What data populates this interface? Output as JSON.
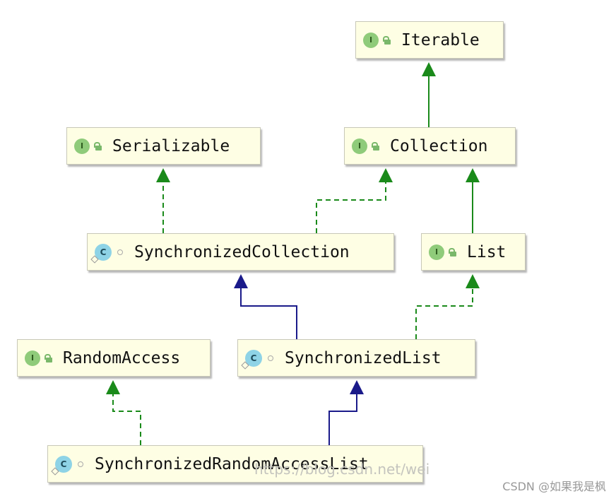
{
  "diagram": {
    "nodes": [
      {
        "id": "iterable",
        "kind": "interface",
        "label": "Iterable"
      },
      {
        "id": "serializable",
        "kind": "interface",
        "label": "Serializable"
      },
      {
        "id": "collection",
        "kind": "interface",
        "label": "Collection"
      },
      {
        "id": "synchronized-collection",
        "kind": "class",
        "label": "SynchronizedCollection"
      },
      {
        "id": "list",
        "kind": "interface",
        "label": "List"
      },
      {
        "id": "random-access",
        "kind": "interface",
        "label": "RandomAccess"
      },
      {
        "id": "synchronized-list",
        "kind": "class",
        "label": "SynchronizedList"
      },
      {
        "id": "synchronized-random-access-list",
        "kind": "class",
        "label": "SynchronizedRandomAccessList"
      }
    ],
    "edges": [
      {
        "from": "collection",
        "to": "iterable",
        "type": "extends-interface",
        "style": "solid",
        "color": "#1a8a1a"
      },
      {
        "from": "synchronized-collection",
        "to": "serializable",
        "type": "implements",
        "style": "dashed",
        "color": "#1a8a1a"
      },
      {
        "from": "synchronized-collection",
        "to": "collection",
        "type": "implements",
        "style": "dashed",
        "color": "#1a8a1a"
      },
      {
        "from": "list",
        "to": "collection",
        "type": "extends-interface",
        "style": "solid",
        "color": "#1a8a1a"
      },
      {
        "from": "synchronized-list",
        "to": "synchronized-collection",
        "type": "extends",
        "style": "solid",
        "color": "#1a1a8a"
      },
      {
        "from": "synchronized-list",
        "to": "list",
        "type": "implements",
        "style": "dashed",
        "color": "#1a8a1a"
      },
      {
        "from": "synchronized-random-access-list",
        "to": "random-access",
        "type": "implements",
        "style": "dashed",
        "color": "#1a8a1a"
      },
      {
        "from": "synchronized-random-access-list",
        "to": "synchronized-list",
        "type": "extends",
        "style": "solid",
        "color": "#1a1a8a"
      }
    ],
    "badges": {
      "interface": "I",
      "class": "C"
    }
  },
  "watermark": "CSDN @如果我是枫",
  "faint_watermark": "https://blog.csdn.net/wei"
}
